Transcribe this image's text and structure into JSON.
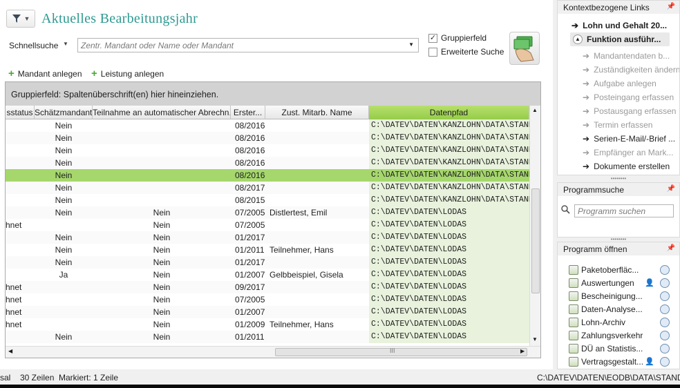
{
  "header": {
    "filter_icon": "funnel-icon",
    "title": "Aktuelles Bearbeitungsjahr"
  },
  "search": {
    "label": "Schnellsuche",
    "placeholder": "Zentr. Mandant oder Name oder Mandant"
  },
  "options": {
    "gruppierfeld": {
      "label": "Gruppierfeld",
      "checked": true
    },
    "erweiterte_suche": {
      "label": "Erweiterte Suche",
      "checked": false
    }
  },
  "actions": {
    "mandant_anlegen": "Mandant anlegen",
    "leistung_anlegen": "Leistung anlegen"
  },
  "grid": {
    "group_hint": "Gruppierfeld: Spaltenüberschrift(en) hier hineinziehen.",
    "columns": [
      "sstatus",
      "Schätzmandant",
      "Teilnahme an automatischer Abrechn...",
      "Erster...",
      "Zust. Mitarb. Name",
      "Datenpfad"
    ],
    "rows": [
      {
        "status": "",
        "schaetz": "Nein",
        "teilnahme": "",
        "erster": "08/2016",
        "mitarb": "",
        "pfad": "C:\\DATEV\\DATEN\\KANZLOHN\\DATA\\STAND"
      },
      {
        "status": "",
        "schaetz": "Nein",
        "teilnahme": "",
        "erster": "08/2016",
        "mitarb": "",
        "pfad": "C:\\DATEV\\DATEN\\KANZLOHN\\DATA\\STAND"
      },
      {
        "status": "",
        "schaetz": "Nein",
        "teilnahme": "",
        "erster": "08/2016",
        "mitarb": "",
        "pfad": "C:\\DATEV\\DATEN\\KANZLOHN\\DATA\\STAND"
      },
      {
        "status": "",
        "schaetz": "Nein",
        "teilnahme": "",
        "erster": "08/2016",
        "mitarb": "",
        "pfad": "C:\\DATEV\\DATEN\\KANZLOHN\\DATA\\STAND"
      },
      {
        "status": "",
        "schaetz": "Nein",
        "teilnahme": "",
        "erster": "08/2016",
        "mitarb": "",
        "pfad": "C:\\DATEV\\DATEN\\KANZLOHN\\DATA\\STAND",
        "selected": true
      },
      {
        "status": "",
        "schaetz": "Nein",
        "teilnahme": "",
        "erster": "08/2017",
        "mitarb": "",
        "pfad": "C:\\DATEV\\DATEN\\KANZLOHN\\DATA\\STAND"
      },
      {
        "status": "",
        "schaetz": "Nein",
        "teilnahme": "",
        "erster": "08/2015",
        "mitarb": "",
        "pfad": "C:\\DATEV\\DATEN\\KANZLOHN\\DATA\\STAND"
      },
      {
        "status": "",
        "schaetz": "Nein",
        "teilnahme": "Nein",
        "erster": "07/2005",
        "mitarb": "Distlertest, Emil",
        "pfad": "C:\\DATEV\\DATEN\\LODAS"
      },
      {
        "status": "hnet",
        "schaetz": "",
        "teilnahme": "Nein",
        "erster": "07/2005",
        "mitarb": "",
        "pfad": "C:\\DATEV\\DATEN\\LODAS"
      },
      {
        "status": "",
        "schaetz": "Nein",
        "teilnahme": "Nein",
        "erster": "01/2017",
        "mitarb": "",
        "pfad": "C:\\DATEV\\DATEN\\LODAS"
      },
      {
        "status": "",
        "schaetz": "Nein",
        "teilnahme": "Nein",
        "erster": "01/2011",
        "mitarb": "Teilnehmer, Hans",
        "pfad": "C:\\DATEV\\DATEN\\LODAS"
      },
      {
        "status": "",
        "schaetz": "Nein",
        "teilnahme": "Nein",
        "erster": "01/2017",
        "mitarb": "",
        "pfad": "C:\\DATEV\\DATEN\\LODAS"
      },
      {
        "status": "",
        "schaetz": "Ja",
        "teilnahme": "Nein",
        "erster": "01/2007",
        "mitarb": "Gelbbeispiel, Gisela",
        "pfad": "C:\\DATEV\\DATEN\\LODAS"
      },
      {
        "status": "hnet",
        "schaetz": "",
        "teilnahme": "Nein",
        "erster": "09/2017",
        "mitarb": "",
        "pfad": "C:\\DATEV\\DATEN\\LODAS"
      },
      {
        "status": "hnet",
        "schaetz": "",
        "teilnahme": "Nein",
        "erster": "07/2005",
        "mitarb": "",
        "pfad": "C:\\DATEV\\DATEN\\LODAS"
      },
      {
        "status": "hnet",
        "schaetz": "",
        "teilnahme": "Nein",
        "erster": "01/2007",
        "mitarb": "",
        "pfad": "C:\\DATEV\\DATEN\\LODAS"
      },
      {
        "status": "hnet",
        "schaetz": "",
        "teilnahme": "Nein",
        "erster": "01/2009",
        "mitarb": "Teilnehmer, Hans",
        "pfad": "C:\\DATEV\\DATEN\\LODAS"
      },
      {
        "status": "",
        "schaetz": "Nein",
        "teilnahme": "Nein",
        "erster": "01/2011",
        "mitarb": "",
        "pfad": "C:\\DATEV\\DATEN\\LODAS"
      }
    ],
    "hscroll_grip": "III"
  },
  "status": {
    "left_cut": "sal",
    "zeilen": "30 Zeilen",
    "markiert": "Markiert: 1 Zeile",
    "path": "C:\\DATEV\\DATEN\\EODB\\DATA\\STAND"
  },
  "right_panel": {
    "kontext": {
      "title": "Kontextbezogene Links",
      "bold_items": [
        "Lohn und Gehalt 20...",
        "Funktion ausführ..."
      ],
      "items": [
        {
          "label": "Mandantendaten b...",
          "enabled": false
        },
        {
          "label": "Zuständigkeiten ändern",
          "enabled": false
        },
        {
          "label": "Aufgabe anlegen",
          "enabled": false
        },
        {
          "label": "Posteingang erfassen",
          "enabled": false
        },
        {
          "label": "Postausgang erfassen",
          "enabled": false
        },
        {
          "label": "Termin erfassen",
          "enabled": false
        },
        {
          "label": "Serien-E-Mail/-Brief ...",
          "enabled": true
        },
        {
          "label": "Empfänger an Mark...",
          "enabled": false
        },
        {
          "label": "Dokumente erstellen",
          "enabled": true
        }
      ]
    },
    "programmsuche": {
      "title": "Programmsuche",
      "placeholder": "Programm suchen"
    },
    "programm_oeffnen": {
      "title": "Programm öffnen",
      "items": [
        {
          "label": "Paketoberfläc...",
          "person": false
        },
        {
          "label": "Auswertungen",
          "person": true
        },
        {
          "label": "Bescheinigung...",
          "person": false
        },
        {
          "label": "Daten-Analyse...",
          "person": false
        },
        {
          "label": "Lohn-Archiv",
          "person": false
        },
        {
          "label": "Zahlungsverkehr",
          "person": false
        },
        {
          "label": "DÜ an Statistis...",
          "person": false
        },
        {
          "label": "Vertragsgestalt...",
          "person": true
        }
      ]
    }
  }
}
